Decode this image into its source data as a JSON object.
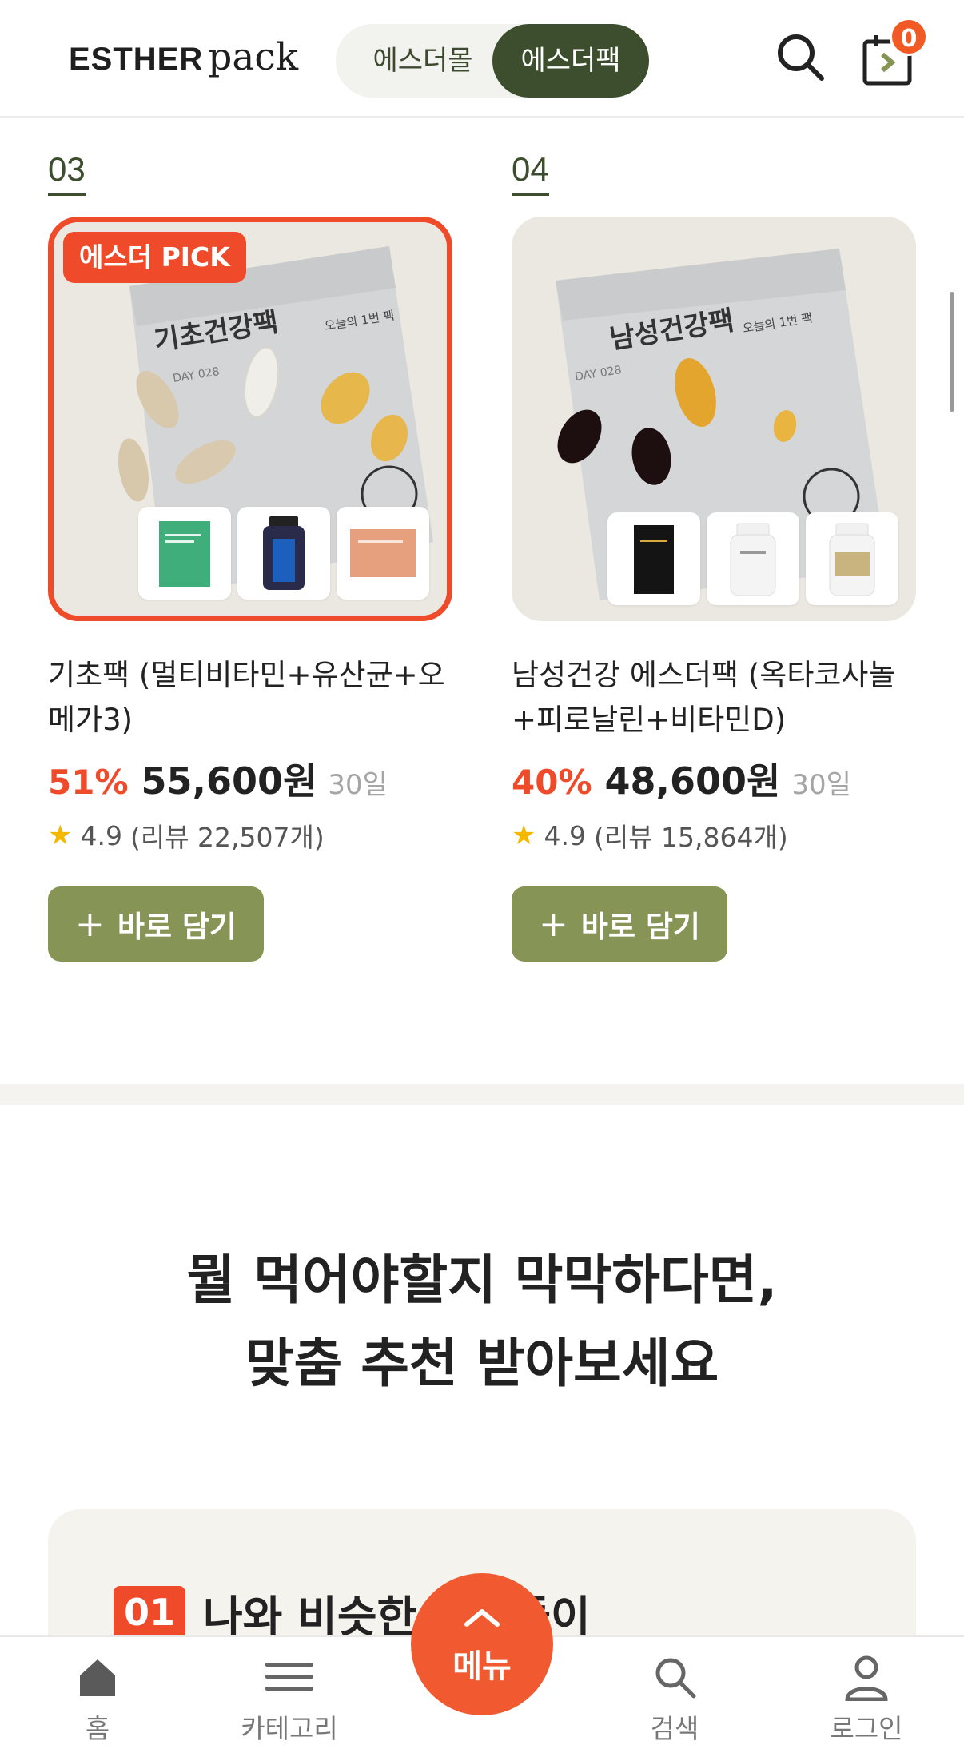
{
  "header": {
    "logo_main": "ESTHER",
    "logo_sub": "pack",
    "tabs": [
      {
        "label": "에스더몰"
      },
      {
        "label": "에스더팩"
      }
    ],
    "active_tab": "에스더팩",
    "cart_count": "0"
  },
  "products": [
    {
      "rank": "03",
      "badge": "에스더 PICK",
      "bag_title": "기초건강팩",
      "bag_sub": "오늘의 1번 팩",
      "bag_day": "DAY 028",
      "name": "기초팩 (멀티비타민+유산균+오메가3)",
      "discount": "51%",
      "price": "55,600원",
      "period": "30일",
      "rating": "4.9",
      "reviews": "(리뷰 22,507개)",
      "button": "바로 담기"
    },
    {
      "rank": "04",
      "badge": "",
      "bag_title": "남성건강팩",
      "bag_sub": "오늘의 1번 팩",
      "bag_day": "DAY 028",
      "name": "남성건강 에스더팩 (옥타코사놀+피로날린+비타민D)",
      "discount": "40%",
      "price": "48,600원",
      "period": "30일",
      "rating": "4.9",
      "reviews": "(리뷰 15,864개)",
      "button": "바로 담기"
    }
  ],
  "recommend": {
    "title_line1": "뭘 먹어야할지 막막하다면,",
    "title_line2": "맞춤 추천 받아보세요",
    "step_number": "01",
    "step_text": "나와 비슷한 사람들이"
  },
  "bottom_nav": {
    "home": "홈",
    "category": "카테고리",
    "menu": "메뉴",
    "search": "검색",
    "login": "로그인"
  },
  "colors": {
    "accent": "#ef4b2b",
    "brand_dark": "#3d4e2f",
    "button_green": "#869456"
  }
}
